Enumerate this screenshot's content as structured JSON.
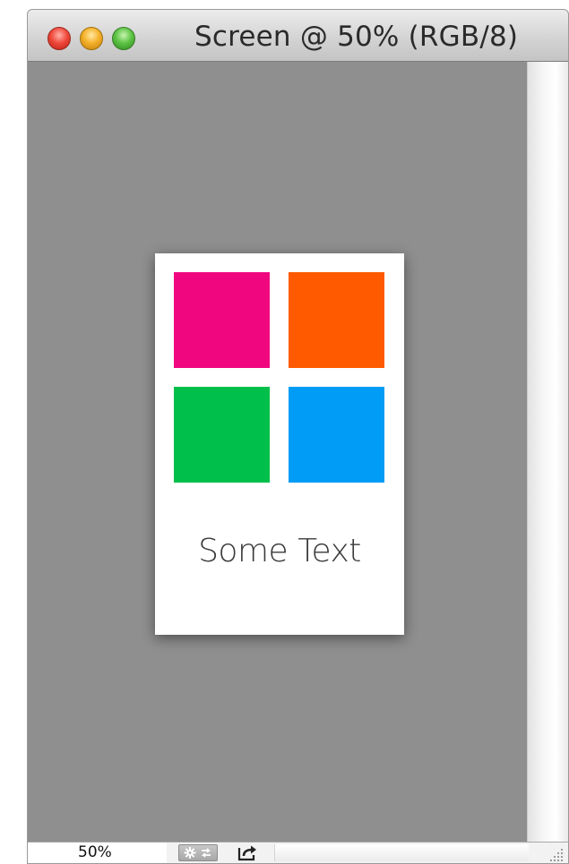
{
  "window": {
    "title": "Screen @ 50% (RGB/8)",
    "controls": [
      "close-button",
      "minimize-button",
      "zoom-button"
    ]
  },
  "document": {
    "background": "#ffffff",
    "swatches": [
      {
        "name": "pink",
        "color": "#f0077f"
      },
      {
        "name": "orange",
        "color": "#ff5a00"
      },
      {
        "name": "green",
        "color": "#00bf4a"
      },
      {
        "name": "blue",
        "color": "#009cf5"
      }
    ],
    "text": "Some Text"
  },
  "status_bar": {
    "zoom": "50%",
    "icons": [
      "gear-arrows-icon",
      "share-icon",
      "resize-grip-icon"
    ]
  },
  "colors": {
    "canvas_background": "#8f8f8f"
  }
}
